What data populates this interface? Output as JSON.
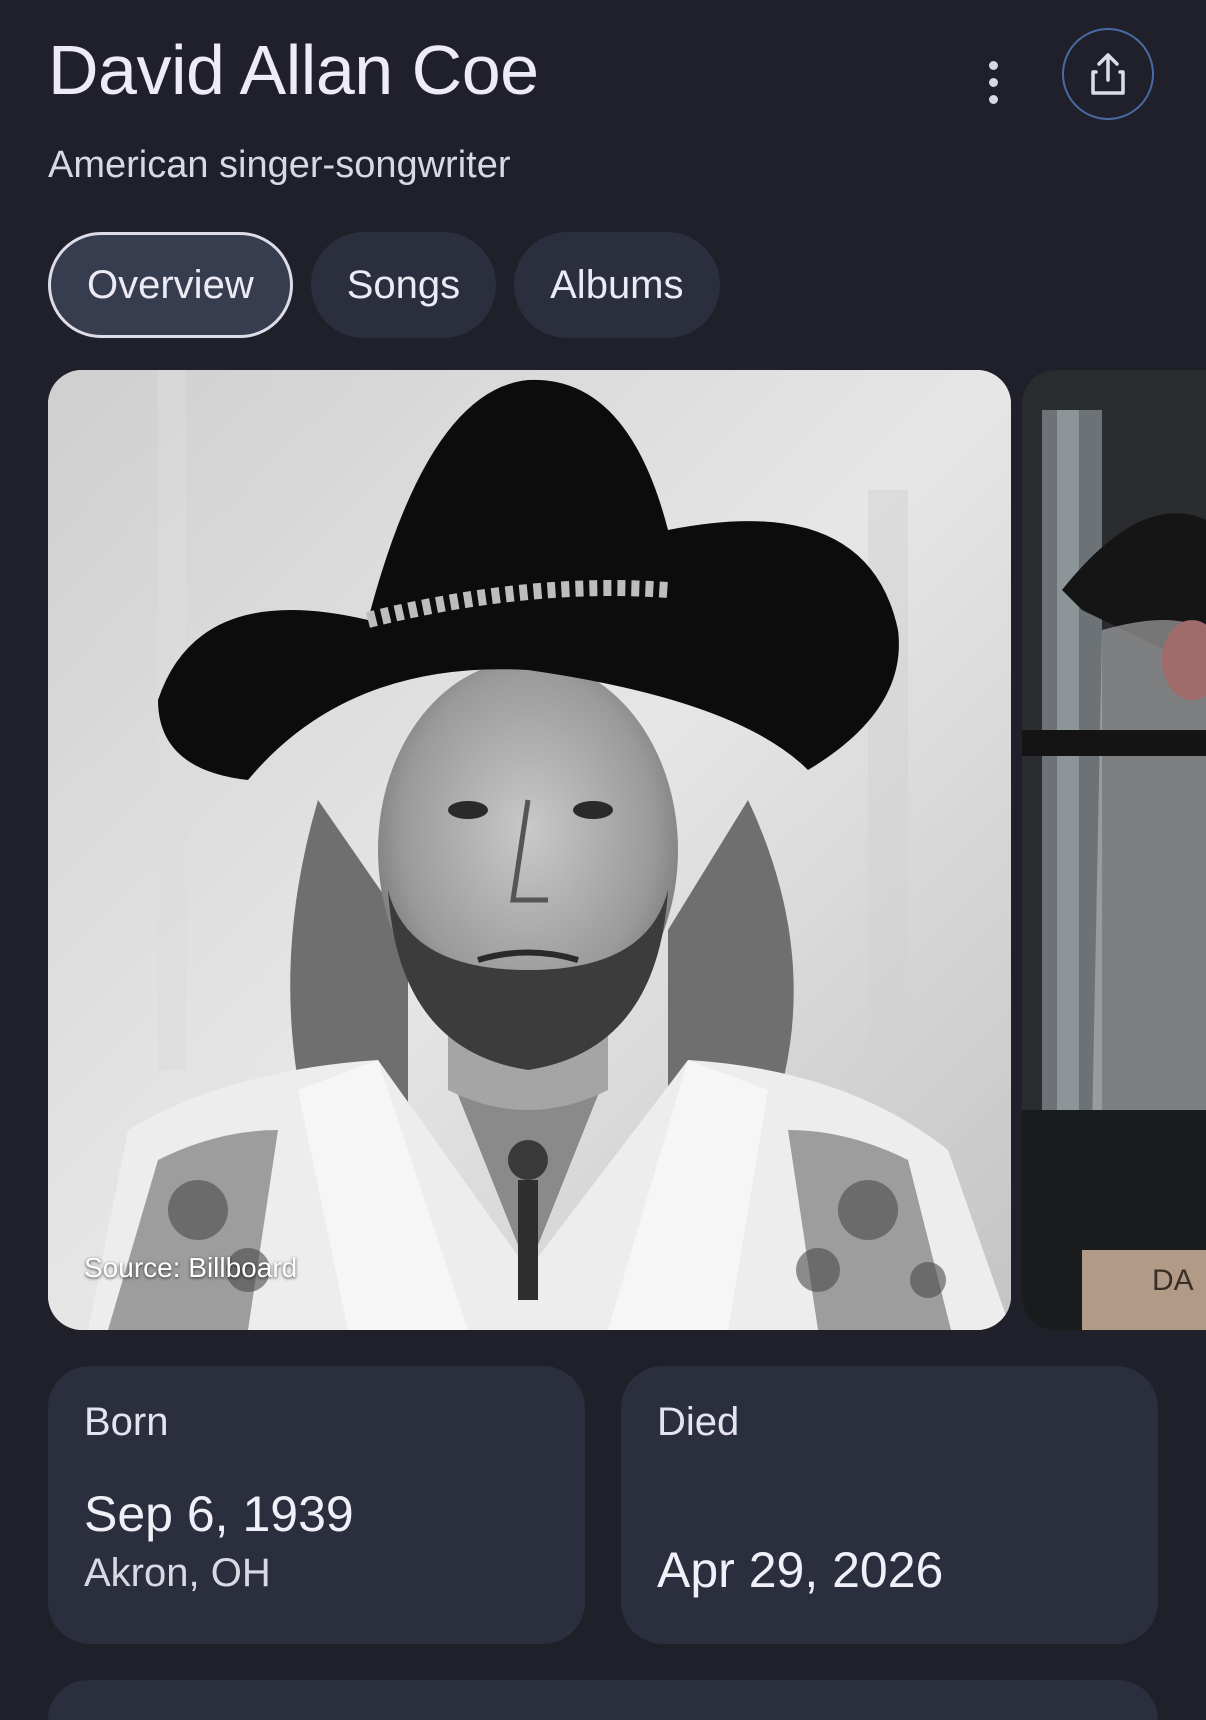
{
  "entity": {
    "name": "David Allan Coe",
    "description": "American singer-songwriter"
  },
  "header": {
    "more_icon": "more-vert-icon",
    "share_icon": "share-icon",
    "share_border_color": "#4a6aa4"
  },
  "tabs": [
    {
      "label": "Overview",
      "active": true
    },
    {
      "label": "Songs",
      "active": false
    },
    {
      "label": "Albums",
      "active": false
    }
  ],
  "images": {
    "main_caption": "Source: Billboard",
    "second_partial_text": "DA"
  },
  "facts": {
    "born": {
      "label": "Born",
      "date": "Sep 6, 1939",
      "place": "Akron, OH"
    },
    "died": {
      "label": "Died",
      "date": "Apr 29, 2026"
    }
  },
  "theme": {
    "background": "#1f2029",
    "chip_background": "#2b2e3d",
    "card_background": "#2b2e3d"
  }
}
